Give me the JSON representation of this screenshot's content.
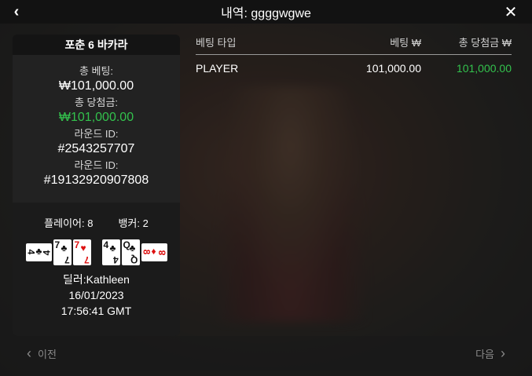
{
  "header": {
    "title": "내역: ggggwgwe"
  },
  "game": {
    "name": "포춘 6 바카라"
  },
  "info": {
    "total_bet_label": "총 베팅:",
    "total_bet_value": "₩101,000.00",
    "total_win_label": "총 당첨금:",
    "total_win_value": "₩101,000.00",
    "round_id_label_1": "라운드 ID:",
    "round_id_value_1": "#2543257707",
    "round_id_label_2": "라운드 ID:",
    "round_id_value_2": "#19132920907808"
  },
  "result": {
    "player_label": "플레이어: 8",
    "banker_label": "뱅커: 2",
    "player_cards": [
      {
        "rank": "4",
        "suit": "♣",
        "color": "black",
        "orientation": "side"
      },
      {
        "rank": "7",
        "suit": "♣",
        "color": "black",
        "orientation": "up"
      },
      {
        "rank": "7",
        "suit": "♥",
        "color": "red",
        "orientation": "up"
      }
    ],
    "banker_cards": [
      {
        "rank": "4",
        "suit": "♣",
        "color": "black",
        "orientation": "up"
      },
      {
        "rank": "Q",
        "suit": "♣",
        "color": "black",
        "orientation": "up"
      },
      {
        "rank": "8",
        "suit": "♦",
        "color": "red",
        "orientation": "side"
      }
    ]
  },
  "dealer": {
    "name": "딜러:Kathleen",
    "date": "16/01/2023",
    "time": "17:56:41 GMT"
  },
  "table": {
    "headers": [
      "베팅 타입",
      "베팅 ₩",
      "총 당첨금 ₩"
    ],
    "rows": [
      {
        "type": "PLAYER",
        "bet": "101,000.00",
        "win": "101,000.00"
      }
    ]
  },
  "footer": {
    "prev_label": "이전",
    "next_label": "다음"
  },
  "colors": {
    "win_green": "#33c24d",
    "header_bg": "#121212"
  },
  "icons": {
    "back": "chevron-left-icon",
    "close": "close-icon"
  }
}
